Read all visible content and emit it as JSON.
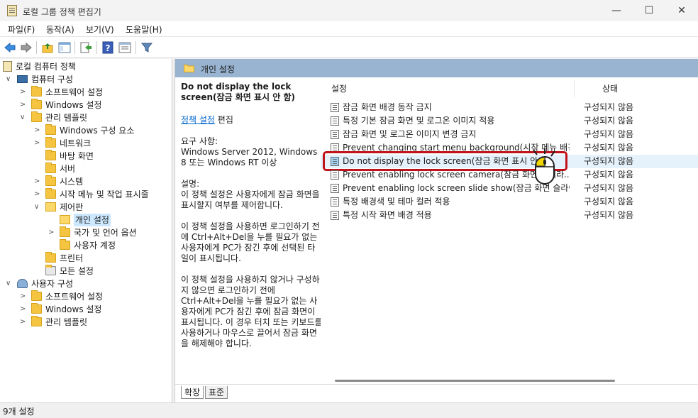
{
  "window": {
    "title": "로컬 그룹 정책 편집기",
    "min": "—",
    "max": "☐",
    "close": "✕"
  },
  "menu": [
    "파일(F)",
    "동작(A)",
    "보기(V)",
    "도움말(H)"
  ],
  "toolbar": {
    "icons": [
      "back-arrow-icon",
      "forward-arrow-icon",
      "up-folder-icon",
      "show-hide-tree-icon",
      "export-list-icon",
      "help-icon",
      "properties-icon",
      "filter-icon"
    ]
  },
  "tree": [
    {
      "label": "로컬 컴퓨터 정책",
      "level": 0,
      "chev": "",
      "icon": "policy"
    },
    {
      "label": "컴퓨터 구성",
      "level": 0,
      "chev": "∨",
      "icon": "computer"
    },
    {
      "label": "소프트웨어 설정",
      "level": 1,
      "chev": ">",
      "icon": "folder"
    },
    {
      "label": "Windows 설정",
      "level": 1,
      "chev": ">",
      "icon": "folder"
    },
    {
      "label": "관리 템플릿",
      "level": 1,
      "chev": "∨",
      "icon": "folder"
    },
    {
      "label": "Windows 구성 요소",
      "level": 2,
      "chev": ">",
      "icon": "folder"
    },
    {
      "label": "네트워크",
      "level": 2,
      "chev": ">",
      "icon": "folder"
    },
    {
      "label": "바탕 화면",
      "level": 2,
      "chev": "",
      "icon": "folder"
    },
    {
      "label": "서버",
      "level": 2,
      "chev": "",
      "icon": "folder"
    },
    {
      "label": "시스템",
      "level": 2,
      "chev": ">",
      "icon": "folder"
    },
    {
      "label": "시작 메뉴 및 작업 표시줄",
      "level": 2,
      "chev": ">",
      "icon": "folder"
    },
    {
      "label": "제어판",
      "level": 2,
      "chev": "∨",
      "icon": "folder-open"
    },
    {
      "label": "개인 설정",
      "level": 3,
      "chev": "",
      "icon": "folder-open",
      "selected": true
    },
    {
      "label": "국가 및 언어 옵션",
      "level": 3,
      "chev": ">",
      "icon": "folder"
    },
    {
      "label": "사용자 계정",
      "level": 3,
      "chev": "",
      "icon": "folder"
    },
    {
      "label": "프린터",
      "level": 2,
      "chev": "",
      "icon": "folder"
    },
    {
      "label": "모든 설정",
      "level": 2,
      "chev": "",
      "icon": "folder-doc"
    },
    {
      "label": "사용자 구성",
      "level": 0,
      "chev": "∨",
      "icon": "user"
    },
    {
      "label": "소프트웨어 설정",
      "level": 1,
      "chev": ">",
      "icon": "folder"
    },
    {
      "label": "Windows 설정",
      "level": 1,
      "chev": ">",
      "icon": "folder"
    },
    {
      "label": "관리 템플릿",
      "level": 1,
      "chev": ">",
      "icon": "folder"
    }
  ],
  "right": {
    "header": "개인 설정",
    "desc": {
      "title": "Do not display the lock screen(잠금 화면 표시 안 함)",
      "link": "정책 설정",
      "edit": " 편집",
      "req_label": "요구 사항:",
      "req_text": "Windows Server 2012, Windows 8 또는 Windows RT 이상",
      "desc_label": "설명:",
      "p1": "이 정책 설정은 사용자에게 잠금 화면을 표시할지 여부를 제어합니다.",
      "p2": "이 정책 설정을 사용하면 로그인하기 전에 Ctrl+Alt+Del을 누를 필요가 없는 사용자에게 PC가 잠긴 후에 선택된 타일이 표시됩니다.",
      "p3": "이 정책 설정을 사용하지 않거나 구성하지 않으면 로그인하기 전에 Ctrl+Alt+Del을 누를 필요가 없는 사용자에게 PC가 잠긴 후에 잠금 화면이 표시됩니다. 이 경우 터치 또는 키보드를 사용하거나 마우스로 끌어서 잠금 화면을 해제해야 합니다."
    },
    "columns": {
      "setting": "설정",
      "state": "상태"
    },
    "rows": [
      {
        "name": "잠금 화면 배경 동작 금지",
        "state": "구성되지 않음"
      },
      {
        "name": "특정 기본 잠금 화면 및 로그온 이미지 적용",
        "state": "구성되지 않음"
      },
      {
        "name": "잠금 화면 및 로그온 이미지 변경 금지",
        "state": "구성되지 않음"
      },
      {
        "name": "Prevent changing start menu background(시작 메뉴 배경...",
        "state": "구성되지 않음"
      },
      {
        "name": "Do not display the lock screen(잠금 화면 표시 안 함)",
        "state": "구성되지 않음",
        "selected": true
      },
      {
        "name": "Prevent enabling lock screen camera(잠금 화면 카메라...",
        "state": "구성되지 않음"
      },
      {
        "name": "Prevent enabling lock screen slide show(잠금 화면 슬라이...",
        "state": "구성되지 않음"
      },
      {
        "name": "특정 배경색 및 테마 컬러 적용",
        "state": "구성되지 않음"
      },
      {
        "name": "특정 시작 화면 배경 적용",
        "state": "구성되지 않음"
      }
    ],
    "tabs": [
      "확장",
      "표준"
    ]
  },
  "status": "9개 설정",
  "colors": {
    "header": "#99b4d1",
    "highlight": "#c0131b",
    "link": "#0066cc"
  }
}
